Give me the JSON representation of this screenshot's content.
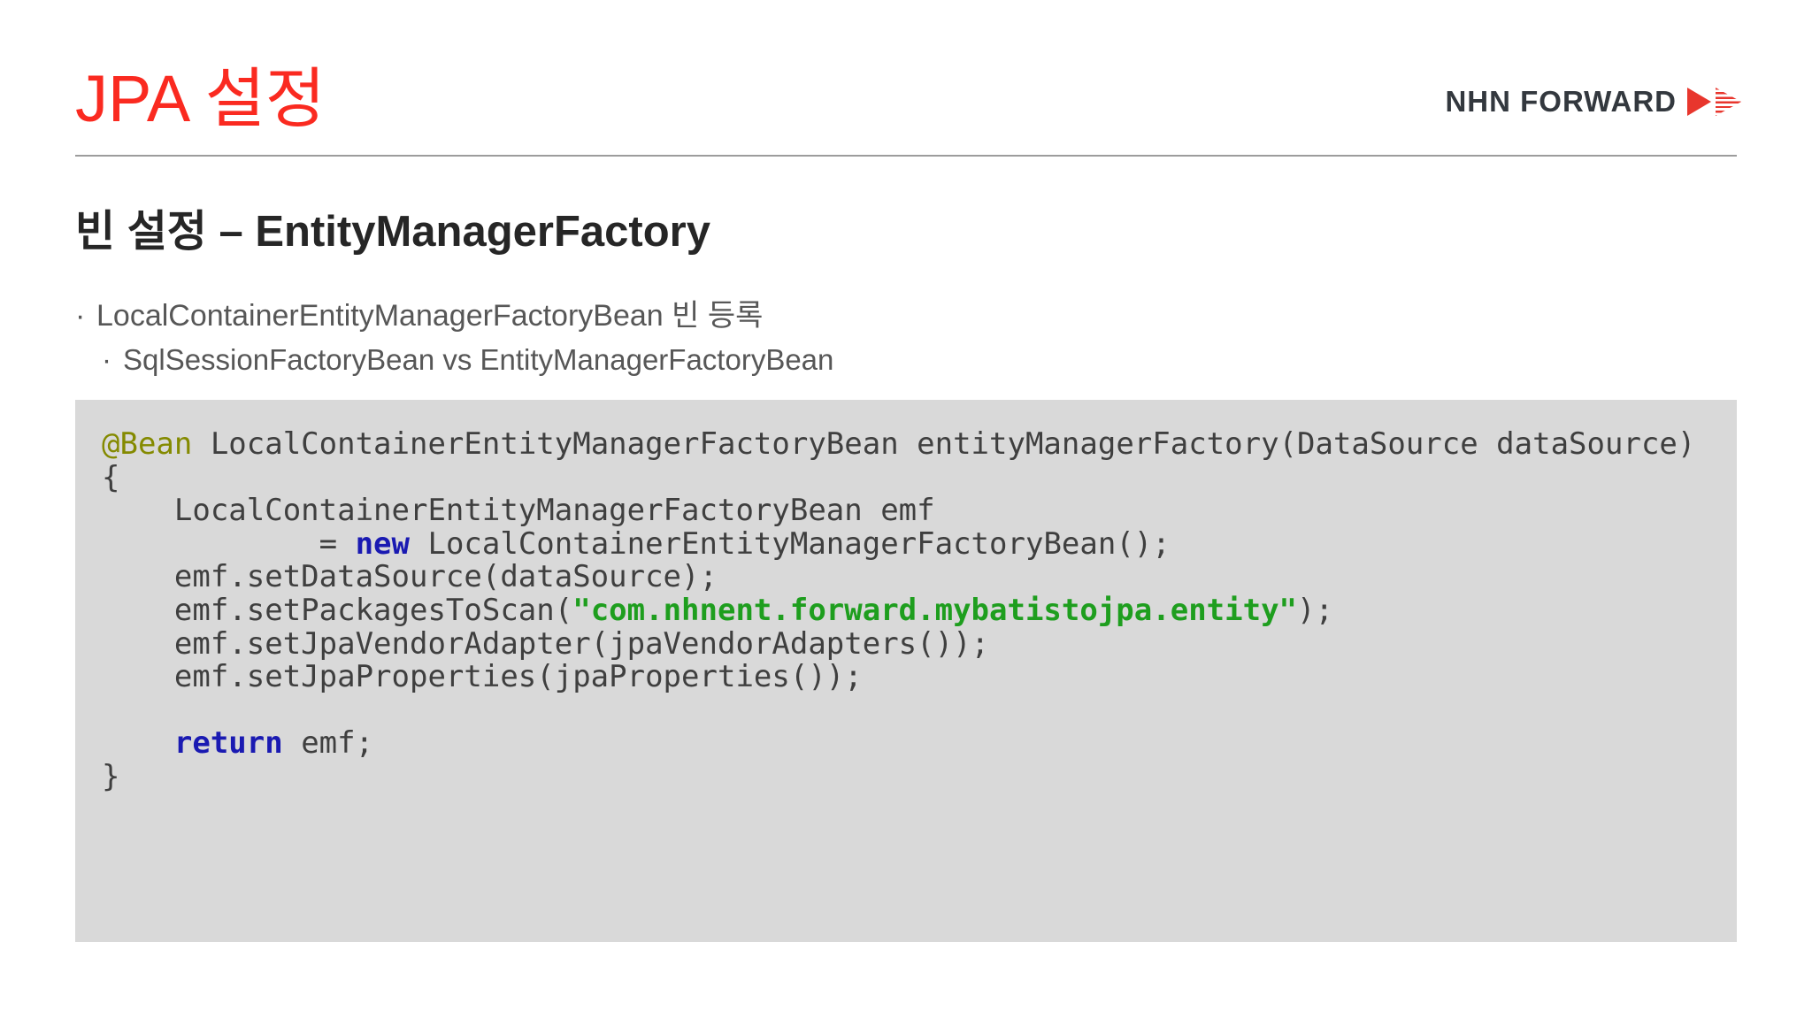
{
  "header": {
    "title": "JPA 설정",
    "title_color": "#fa2a20",
    "logo": {
      "text": "NHN FORWARD",
      "text_color": "#33383e",
      "arrow_color": "#e8362d"
    }
  },
  "content": {
    "subtitle": "빈 설정 – EntityManagerFactory",
    "bullets": [
      {
        "marker": "·",
        "level": 1,
        "text": "LocalContainerEntityManagerFactoryBean 빈 등록"
      },
      {
        "marker": "·",
        "level": 2,
        "text": "SqlSessionFactoryBean vs EntityManagerFactoryBean"
      }
    ]
  },
  "code_block": {
    "background": "#d9d9d9",
    "colors": {
      "plain": "#3f3f3f",
      "annotation": "#848a00",
      "keyword": "#1a1ab2",
      "string": "#1e9e1e"
    },
    "lines": [
      [
        [
          "annotation",
          "@Bean"
        ],
        [
          "plain",
          " LocalContainerEntityManagerFactoryBean entityManagerFactory(DataSource dataSource)"
        ]
      ],
      [
        [
          "plain",
          "{"
        ]
      ],
      [
        [
          "plain",
          "    LocalContainerEntityManagerFactoryBean emf"
        ]
      ],
      [
        [
          "plain",
          "            = "
        ],
        [
          "keyword",
          "new"
        ],
        [
          "plain",
          " LocalContainerEntityManagerFactoryBean();"
        ]
      ],
      [
        [
          "plain",
          "    emf.setDataSource(dataSource);"
        ]
      ],
      [
        [
          "plain",
          "    emf.setPackagesToScan("
        ],
        [
          "string",
          "\"com.nhnent.forward.mybatistojpa.entity\""
        ],
        [
          "plain",
          ");"
        ]
      ],
      [
        [
          "plain",
          "    emf.setJpaVendorAdapter(jpaVendorAdapters());"
        ]
      ],
      [
        [
          "plain",
          "    emf.setJpaProperties(jpaProperties());"
        ]
      ],
      [
        [
          "plain",
          ""
        ]
      ],
      [
        [
          "plain",
          "    "
        ],
        [
          "keyword",
          "return"
        ],
        [
          "plain",
          " emf;"
        ]
      ],
      [
        [
          "plain",
          "}"
        ]
      ]
    ]
  }
}
